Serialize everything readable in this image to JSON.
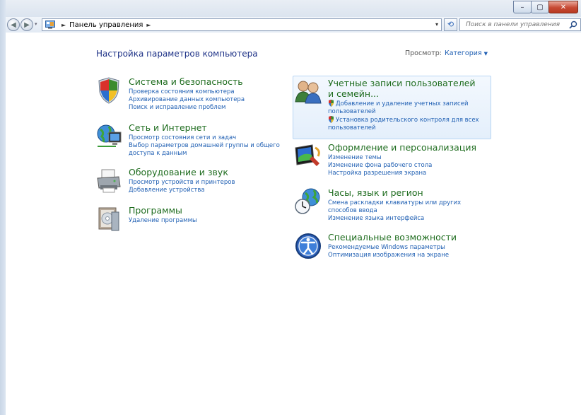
{
  "window": {
    "controls": {
      "minimize": "–",
      "maximize": "▢",
      "close": "✕"
    }
  },
  "nav": {
    "back_label": "◀",
    "forward_label": "▶",
    "breadcrumb_sep": "►",
    "breadcrumb": "Панель управления",
    "breadcrumb_end": "►",
    "dropdown": "▾",
    "refresh": "⟲",
    "search_placeholder": "Поиск в панели управления"
  },
  "page": {
    "title": "Настройка параметров компьютера",
    "view_label": "Просмотр:",
    "view_value": "Категория",
    "view_caret": "▼"
  },
  "categories_left": [
    {
      "title": "Система и безопасность",
      "icon": "shield-icon",
      "links": [
        "Проверка состояния компьютера",
        "Архивирование данных компьютера",
        "Поиск и исправление проблем"
      ]
    },
    {
      "title": "Сеть и Интернет",
      "icon": "network-globe-icon",
      "links": [
        "Просмотр состояния сети и задач",
        "Выбор параметров домашней группы и общего доступа к данным"
      ]
    },
    {
      "title": "Оборудование и звук",
      "icon": "printer-icon",
      "links": [
        "Просмотр устройств и принтеров",
        "Добавление устройства"
      ]
    },
    {
      "title": "Программы",
      "icon": "programs-icon",
      "links": [
        "Удаление программы"
      ]
    }
  ],
  "categories_right": [
    {
      "title": "Учетные записи пользователей и семейн...",
      "icon": "users-icon",
      "links": [
        "Добавление и удаление учетных записей пользователей",
        "Установка родительского контроля для всех пользователей"
      ]
    },
    {
      "title": "Оформление и персонализация",
      "icon": "display-icon",
      "links": [
        "Изменение темы",
        "Изменение фона рабочего стола",
        "Настройка разрешения экрана"
      ]
    },
    {
      "title": "Часы, язык и регион",
      "icon": "clock-globe-icon",
      "links": [
        "Смена раскладки клавиатуры или других способов ввода",
        "Изменение языка интерфейса"
      ]
    },
    {
      "title": "Специальные возможности",
      "icon": "accessibility-icon",
      "links": [
        "Рекомендуемые Windows параметры",
        "Оптимизация изображения на экране"
      ]
    }
  ]
}
